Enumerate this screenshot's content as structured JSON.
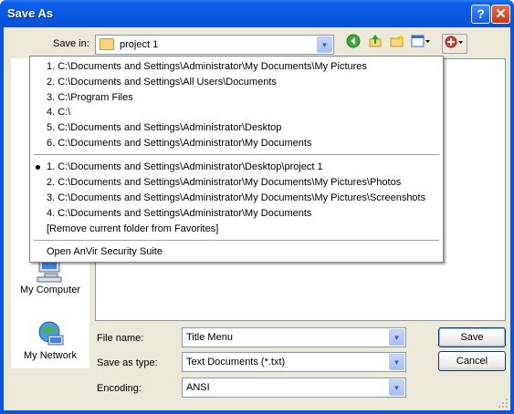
{
  "window": {
    "title": "Save As",
    "help_glyph": "?",
    "close_glyph": "✕"
  },
  "save_in": {
    "label": "Save in:",
    "value": "project 1"
  },
  "toolbar": {
    "icons": [
      "back-icon",
      "up-folder-icon",
      "new-folder-icon",
      "views-menu-icon",
      "favorites-menu-icon"
    ]
  },
  "places": {
    "items": [
      {
        "label": "My Computer",
        "icon": "computer-icon"
      },
      {
        "label": "My Network",
        "icon": "network-icon"
      }
    ]
  },
  "dropdown": {
    "recent_folders": [
      "1. C:\\Documents and Settings\\Administrator\\My Documents\\My Pictures",
      "2. C:\\Documents and Settings\\All Users\\Documents",
      "3. C:\\Program Files",
      "4. C:\\",
      "5. C:\\Documents and Settings\\Administrator\\Desktop",
      "6. C:\\Documents and Settings\\Administrator\\My Documents"
    ],
    "favorite_folders": [
      "1. C:\\Documents and Settings\\Administrator\\Desktop\\project 1",
      "2. C:\\Documents and Settings\\Administrator\\My Documents\\My Pictures\\Photos",
      "3. C:\\Documents and Settings\\Administrator\\My Documents\\My Pictures\\Screenshots",
      "4. C:\\Documents and Settings\\Administrator\\My Documents"
    ],
    "remove_favorite": "[Remove current folder from Favorites]",
    "open_app": "Open AnVir Security Suite"
  },
  "form": {
    "file_name_label": "File name:",
    "file_name_value": "Title Menu",
    "save_type_label": "Save as type:",
    "save_type_value": "Text Documents (*.txt)",
    "encoding_label": "Encoding:",
    "encoding_value": "ANSI"
  },
  "buttons": {
    "save": "Save",
    "cancel": "Cancel"
  },
  "colors": {
    "titlebar": "#0858e0",
    "face": "#ece9d8",
    "border": "#7f9db9"
  }
}
